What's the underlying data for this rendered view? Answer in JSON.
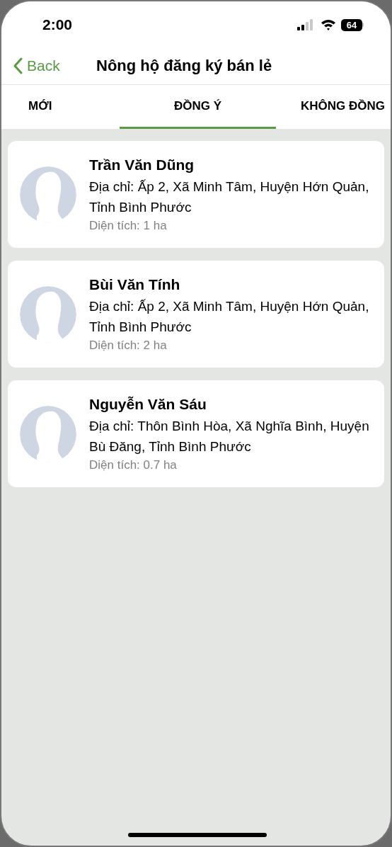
{
  "status_bar": {
    "time": "2:00",
    "battery": "64"
  },
  "nav": {
    "back": "Back",
    "title": "Nông hộ đăng ký bán lẻ"
  },
  "tabs": [
    {
      "label": "MỚI",
      "selected": false
    },
    {
      "label": "ĐỒNG Ý",
      "selected": true
    },
    {
      "label": "KHÔNG ĐỒNG",
      "selected": false
    }
  ],
  "farmers": [
    {
      "name": "Trần Văn Dũng",
      "address": "Địa chỉ: Ấp 2, Xã Minh Tâm, Huyện Hớn Quản, Tỉnh Bình Phước",
      "area": "Diện tích: 1 ha"
    },
    {
      "name": "Bùi Văn Tính",
      "address": "Địa chỉ: Ấp 2, Xã Minh Tâm, Huyện Hớn Quản, Tỉnh Bình Phước",
      "area": "Diện tích: 2 ha"
    },
    {
      "name": "Nguyễn Văn Sáu",
      "address": "Địa chỉ: Thôn Bình Hòa, Xã Nghĩa Bình, Huyện Bù Đăng, Tỉnh Bình Phước",
      "area": "Diện tích: 0.7 ha"
    }
  ]
}
